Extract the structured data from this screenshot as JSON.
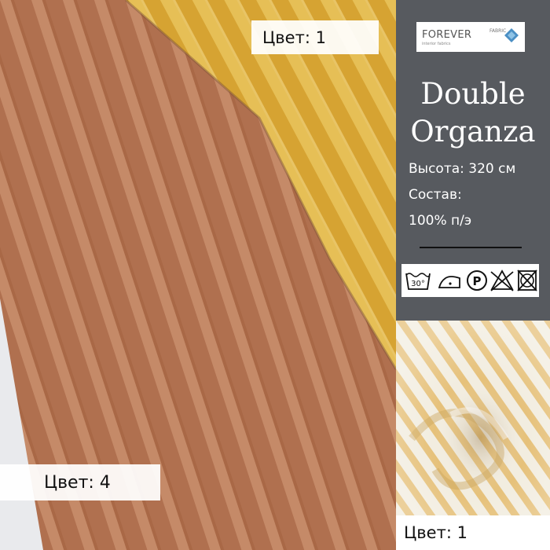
{
  "image": {
    "description_labels": {
      "top_color_label": "Цвет: 1",
      "bottom_color_label": "Цвет: 4",
      "photo_color_label": "Цвет: 1"
    },
    "colors": {
      "fabric_yellow": "#d9a93b",
      "fabric_yellow_stripe": "#e8c35f",
      "fabric_brown": "#b0704f",
      "fabric_brown_stripe": "#c58a68",
      "panel_bg": "#575a5f",
      "background": "#e9eaed"
    }
  },
  "brand": {
    "logo_text": "FOREVER",
    "logo_subtext": "interior fabrics",
    "logo_fabric_text": "FABRIC",
    "logo_icon": "diamond-logo-icon"
  },
  "product": {
    "title_line1": "Double",
    "title_line2": "Organza",
    "height_line": "Высота: 320 см",
    "composition_label": "Состав:",
    "composition_value": "100% п/э"
  },
  "care_icons": [
    {
      "name": "wash-30-icon",
      "text": "30°"
    },
    {
      "name": "iron-low-icon",
      "text": ""
    },
    {
      "name": "dry-clean-p-icon",
      "text": "P"
    },
    {
      "name": "no-bleach-icon",
      "text": ""
    },
    {
      "name": "no-tumble-dry-icon",
      "text": ""
    }
  ]
}
